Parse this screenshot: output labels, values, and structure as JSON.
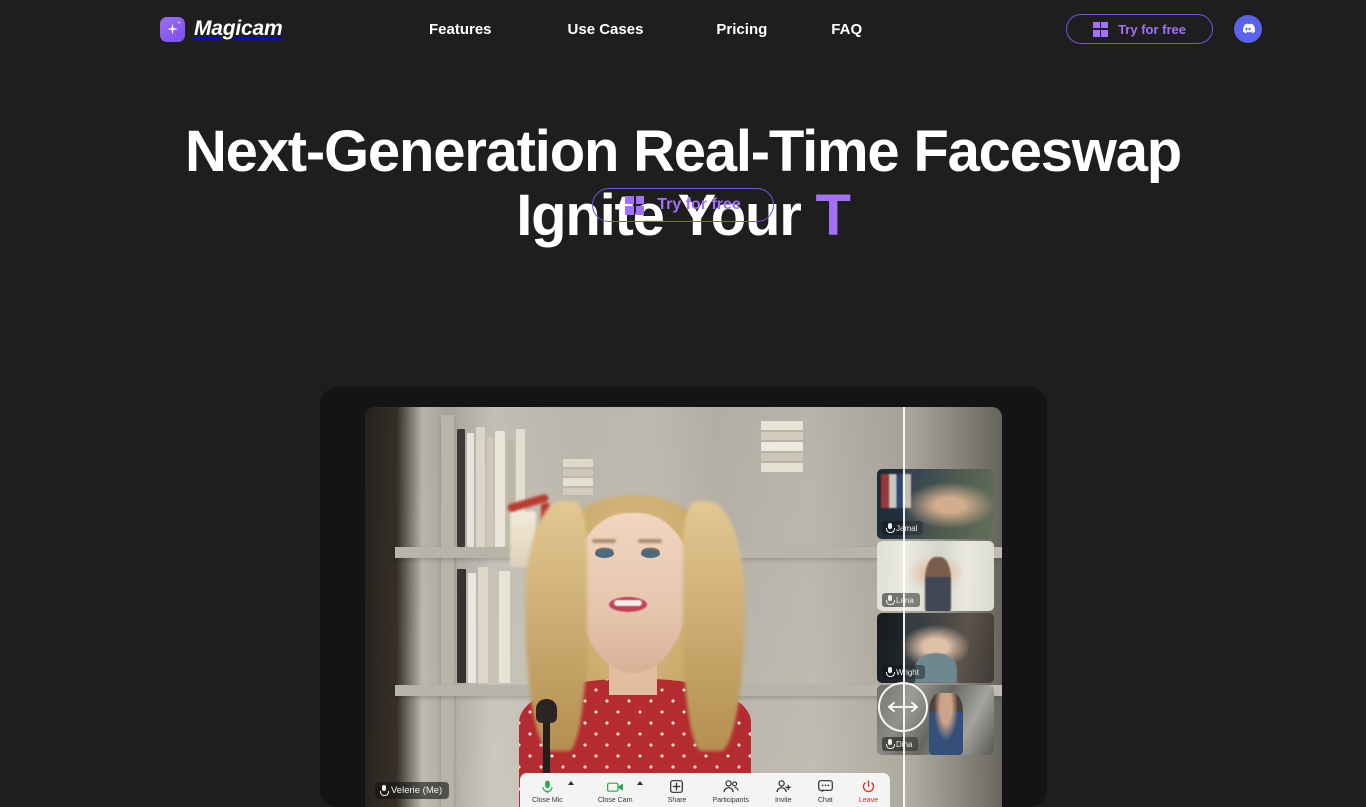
{
  "theme": {
    "background": "#1e1e1e",
    "accent_purple": "#a371f7",
    "accent_border": "#7b4fe0",
    "discord_blue": "#5b63ea",
    "leave_red": "#d93025"
  },
  "header": {
    "brand": {
      "name": "Magicam",
      "icon": "sparkle-icon"
    },
    "nav": [
      {
        "label": "Features"
      },
      {
        "label": "Use Cases"
      },
      {
        "label": "Pricing"
      },
      {
        "label": "FAQ"
      }
    ],
    "cta": {
      "label": "Try for free",
      "icon": "windows-icon"
    },
    "discord": {
      "icon": "discord-icon",
      "label": "Discord"
    }
  },
  "hero": {
    "headline_line1": "Next-Generation Real-Time Faceswap",
    "headline_line2_static": "Ignite Your ",
    "headline_line2_typed": "T",
    "cta": {
      "label": "Try for free",
      "icon": "windows-icon"
    }
  },
  "mockup": {
    "self_label": "Velerie (Me)",
    "participants": [
      {
        "name": "Jamal",
        "icon": "mic-icon"
      },
      {
        "name": "Lena",
        "icon": "mic-icon"
      },
      {
        "name": "Wright",
        "icon": "mic-icon"
      },
      {
        "name": "Dina",
        "icon": "mic-icon"
      }
    ],
    "slider": {
      "icon": "left-right-arrow-icon"
    },
    "toolbar": [
      {
        "label": "Close Mic",
        "icon": "microphone-icon",
        "caret": true
      },
      {
        "label": "Close Cam",
        "icon": "camera-icon",
        "caret": true
      },
      {
        "label": "Share",
        "icon": "share-plus-icon",
        "caret": false
      },
      {
        "label": "Participants",
        "icon": "people-icon",
        "caret": false
      },
      {
        "label": "Invite",
        "icon": "person-add-icon",
        "caret": false
      },
      {
        "label": "Chat",
        "icon": "chat-bubble-icon",
        "caret": false
      },
      {
        "label": "Leave",
        "icon": "power-icon",
        "caret": false
      }
    ]
  }
}
